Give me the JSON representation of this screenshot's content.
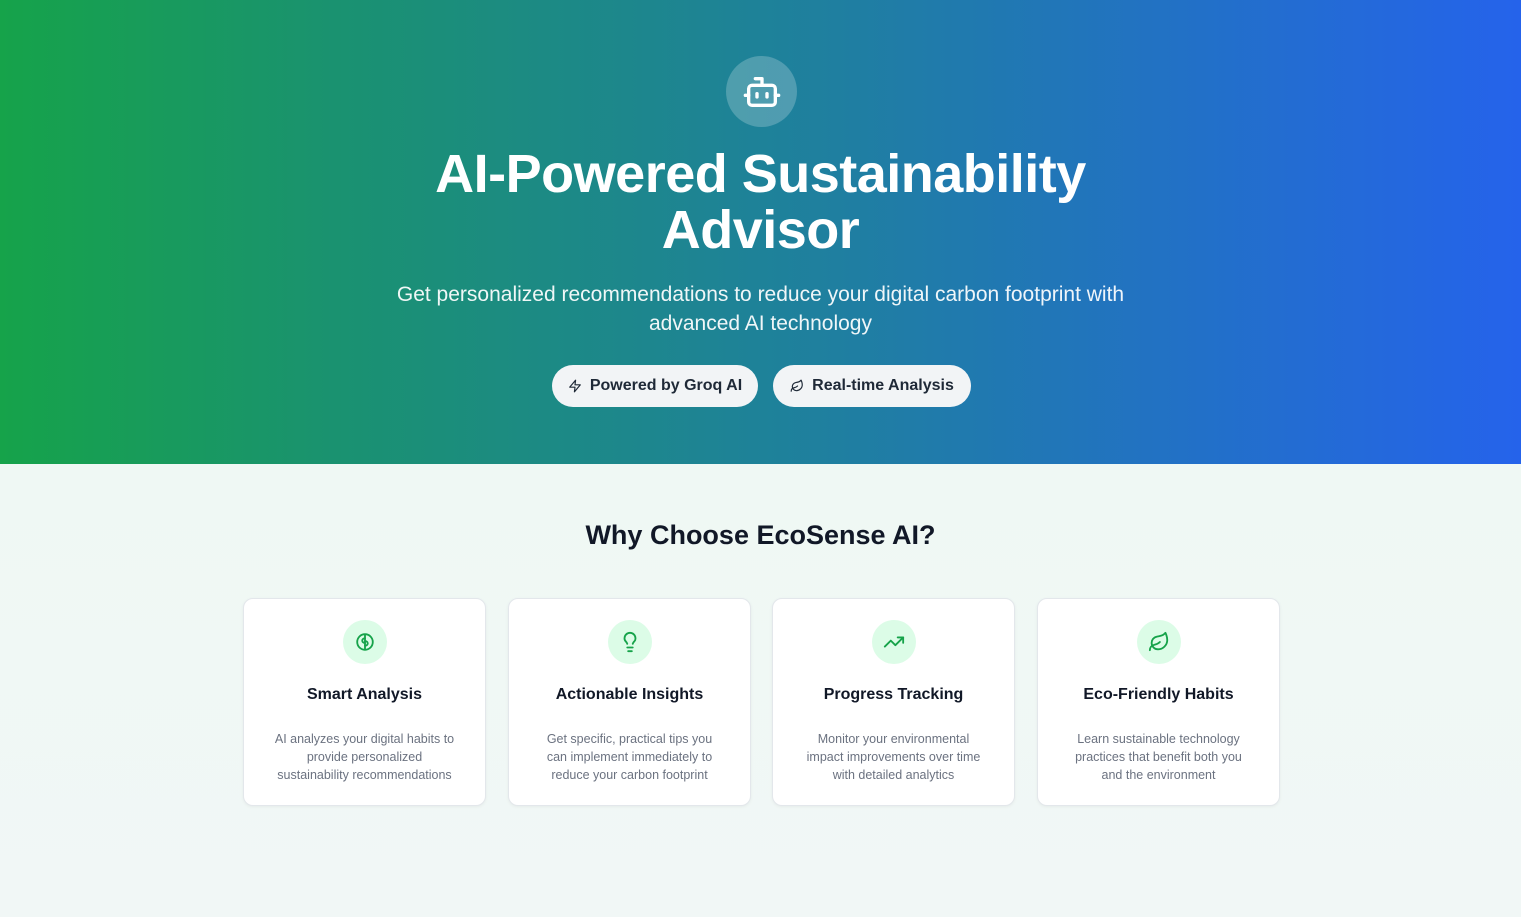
{
  "hero": {
    "icon": "robot-icon",
    "title_line1": "AI-Powered Sustainability",
    "title_line2": "Advisor",
    "subtitle_line1": "Get personalized recommendations to reduce your digital carbon footprint with",
    "subtitle_line2": "advanced AI technology",
    "badges": [
      {
        "label": "Powered by Groq AI",
        "icon": "zap-icon"
      },
      {
        "label": "Real-time Analysis",
        "icon": "leaf-icon"
      }
    ]
  },
  "features": {
    "title": "Why Choose EcoSense AI?",
    "cards": [
      {
        "icon": "brain-icon",
        "title": "Smart Analysis",
        "desc_lines": [
          "AI analyzes your digital habits to",
          "provide personalized",
          "sustainability recommendations"
        ]
      },
      {
        "icon": "lightbulb-icon",
        "title": "Actionable Insights",
        "desc_lines": [
          "Get specific, practical tips you",
          "can implement immediately to",
          "reduce your carbon footprint"
        ]
      },
      {
        "icon": "trending-up-icon",
        "title": "Progress Tracking",
        "desc_lines": [
          "Monitor your environmental",
          "impact improvements over time",
          "with detailed analytics"
        ]
      },
      {
        "icon": "leaf-icon",
        "title": "Eco-Friendly Habits",
        "desc_lines": [
          "Learn sustainable technology",
          "practices that benefit both you",
          "and the environment"
        ]
      }
    ]
  },
  "colors": {
    "hero_gradient_start": "#16a34a",
    "hero_gradient_end": "#2563eb",
    "icon_green": "#16a34a",
    "icon_bg": "#dcfce7"
  }
}
